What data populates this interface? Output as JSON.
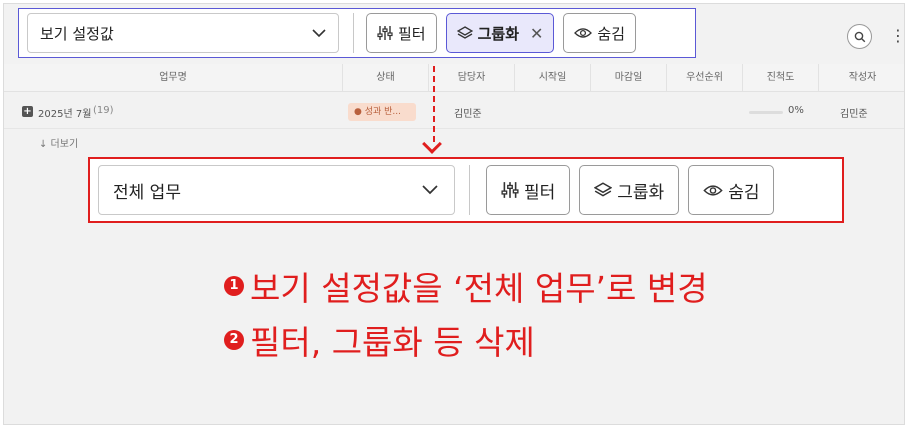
{
  "top_toolbar": {
    "view_select_value": "보기 설정값",
    "filter_label": "필터",
    "group_label": "그룹화",
    "hide_label": "숨김"
  },
  "table": {
    "columns": [
      "업무명",
      "상태",
      "담당자",
      "시작일",
      "마감일",
      "우선순위",
      "진척도",
      "작성자"
    ],
    "group_row": {
      "label": "2025년 7월",
      "count": "(19)",
      "status": "● 성과 반...",
      "assignee": "김민준",
      "progress_text": "0%",
      "progress_value": 0,
      "author": "김민준"
    },
    "more_label": "↓ 더보기"
  },
  "bottom_toolbar": {
    "view_select_value": "전체 업무",
    "filter_label": "필터",
    "group_label": "그룹화",
    "hide_label": "숨김"
  },
  "notes": [
    {
      "number": "1",
      "text": "보기 설정값을 ‘전체 업무’로 변경"
    },
    {
      "number": "2",
      "text": "필터, 그룹화 등 삭제"
    }
  ],
  "colors": {
    "highlight_red": "#e01e1e",
    "active_purple": "#5b59d6",
    "active_bg": "#e9e8fb",
    "status_badge_bg": "#f9dccd"
  },
  "icons": [
    "chevron-down-icon",
    "filter-sliders-icon",
    "layers-icon",
    "close-icon",
    "eye-icon",
    "search-icon",
    "more-vertical-icon",
    "plus-square-icon",
    "arrow-down-icon"
  ]
}
